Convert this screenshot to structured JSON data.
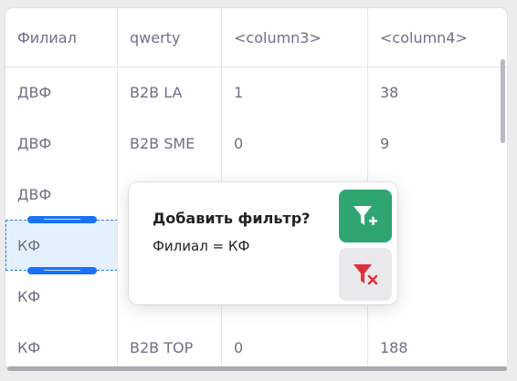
{
  "table": {
    "headers": [
      "Филиал",
      "qwerty",
      "<column3>",
      "<column4>"
    ],
    "rows": [
      [
        "ДВФ",
        "B2B LA",
        "1",
        "38"
      ],
      [
        "ДВФ",
        "B2B SME",
        "0",
        "9"
      ],
      [
        "ДВФ",
        "",
        "",
        ""
      ],
      [
        "КФ",
        "",
        "",
        ""
      ],
      [
        "КФ",
        "",
        "",
        ""
      ],
      [
        "КФ",
        "B2B TOP",
        "0",
        "188"
      ]
    ]
  },
  "popup": {
    "title": "Добавить фильтр?",
    "expression": "Филиал = КФ",
    "add_icon": "filter-plus-icon",
    "remove_icon": "filter-remove-icon"
  },
  "colors": {
    "accent_green": "#2fa572",
    "accent_red": "#e0303a",
    "selection_blue": "#1a73f3"
  }
}
